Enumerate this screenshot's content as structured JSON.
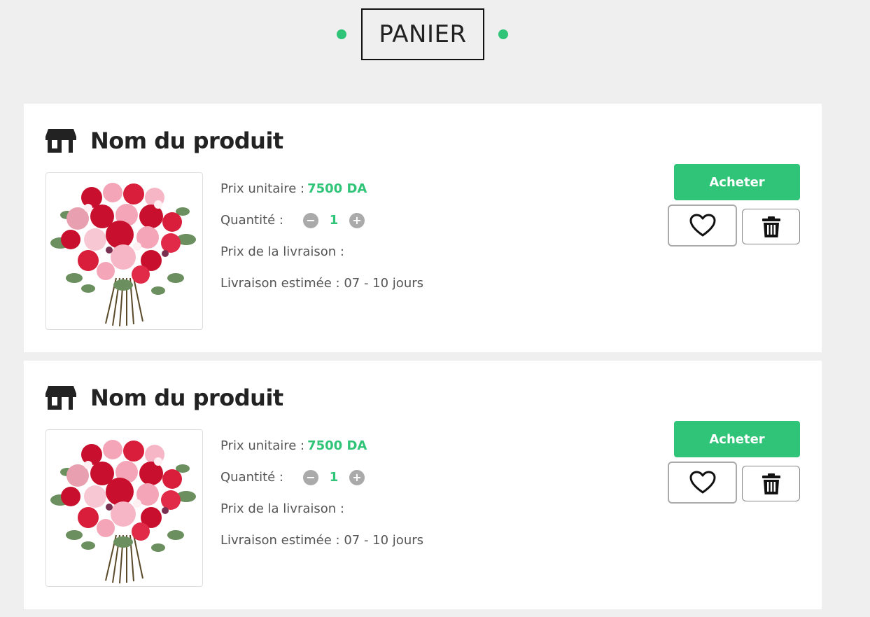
{
  "header": {
    "title": "PANIER"
  },
  "colors": {
    "accent": "#2fc477",
    "background": "#efefef"
  },
  "cart_items": [
    {
      "name": "Nom du produit",
      "unit_price_label": "Prix unitaire :",
      "unit_price_value": "7500 DA",
      "quantity_label": "Quantité :",
      "quantity_value": "1",
      "delivery_price_label": "Prix de la livraison :",
      "estimated_delivery_label": "Livraison estimée : 07 - 10 jours",
      "buy_label": "Acheter",
      "icons": [
        "store-icon",
        "heart-icon",
        "trash-icon",
        "minus-icon",
        "plus-icon"
      ]
    },
    {
      "name": "Nom du produit",
      "unit_price_label": "Prix unitaire :",
      "unit_price_value": "7500 DA",
      "quantity_label": "Quantité :",
      "quantity_value": "1",
      "delivery_price_label": "Prix de la livraison :",
      "estimated_delivery_label": "Livraison estimée : 07 - 10 jours",
      "buy_label": "Acheter",
      "icons": [
        "store-icon",
        "heart-icon",
        "trash-icon",
        "minus-icon",
        "plus-icon"
      ]
    }
  ]
}
